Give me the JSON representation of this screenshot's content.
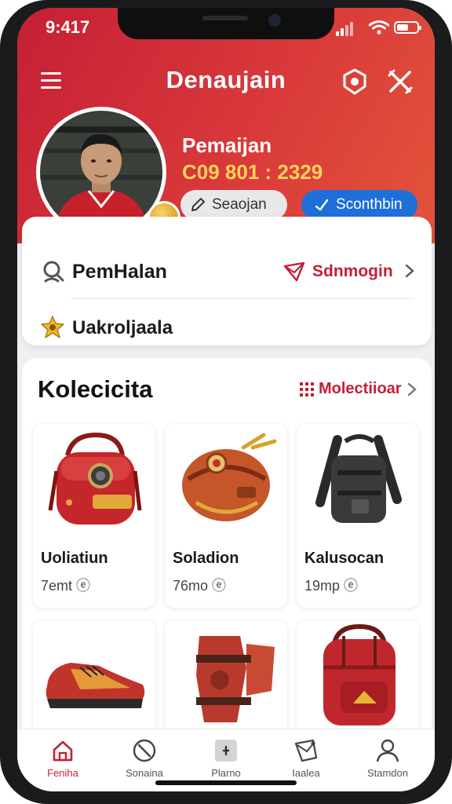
{
  "status_bar": {
    "time": "9:417"
  },
  "header": {
    "title": "Denaujain",
    "menu_icon": "hamburger-icon",
    "action_icons": [
      "badge-icon",
      "cross-tools-icon"
    ]
  },
  "profile": {
    "name": "Pemaijan",
    "phone": "C09 801 : 2329",
    "edit_label": "Seaojan",
    "share_label": "Sconthbin",
    "badge_icon": "gold-medal-icon"
  },
  "menu": {
    "row1_label": "PemHalan",
    "row1_link_label": "Sdnmogin",
    "row2_label": "Uakroljaala"
  },
  "collection": {
    "title": "Kolecicita",
    "more_label": "Molectiioar",
    "products": [
      {
        "name": "Uoliatiun",
        "price": "7emt ⓔ"
      },
      {
        "name": "Soladion",
        "price": "76mo ⓔ"
      },
      {
        "name": "Kalusocan",
        "price": "19mp ⓔ"
      },
      {
        "image": "sneaker"
      },
      {
        "image": "knee-pads"
      },
      {
        "image": "red-backpack"
      }
    ]
  },
  "tabbar": {
    "items": [
      {
        "label": "Feniha",
        "icon": "home-icon",
        "active": true
      },
      {
        "label": "Sonaina",
        "icon": "compass-icon",
        "active": false
      },
      {
        "label": "Plarno",
        "icon": "plus-box-icon",
        "active": false
      },
      {
        "label": "Iaalea",
        "icon": "tag-icon",
        "active": false
      },
      {
        "label": "Stamdon",
        "icon": "profile-icon",
        "active": false
      }
    ]
  },
  "colors": {
    "brand_red": "#c51f35",
    "accent_yellow": "#ffd25a",
    "share_blue": "#1f6fd8"
  }
}
